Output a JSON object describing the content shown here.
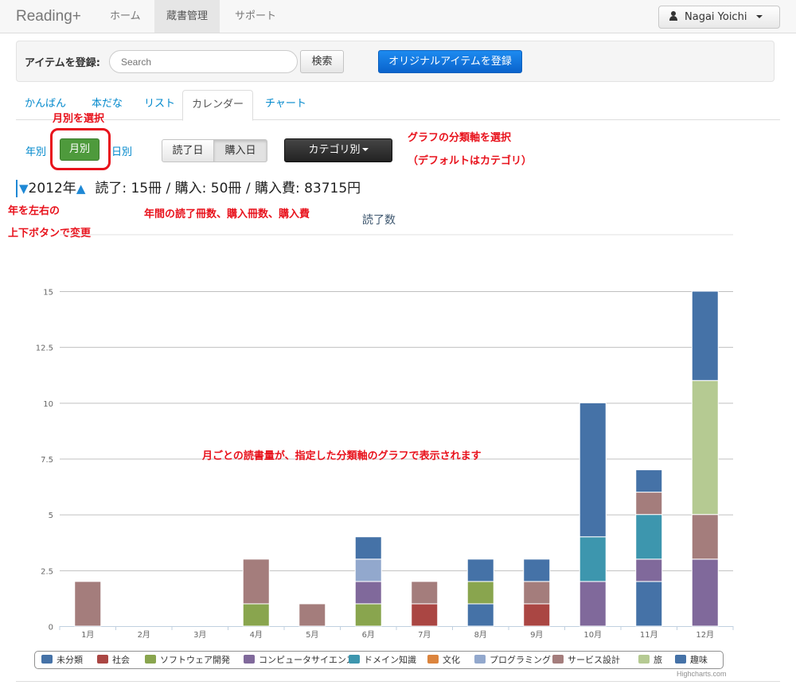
{
  "navbar": {
    "brand": "Reading+",
    "items": [
      {
        "label": "ホーム"
      },
      {
        "label": "蔵書管理"
      },
      {
        "label": "サポート"
      }
    ],
    "user": "Nagai Yoichi"
  },
  "register": {
    "label": "アイテムを登録:",
    "search_placeholder": "Search",
    "search_button": "検索",
    "original_button": "オリジナルアイテムを登録"
  },
  "tabs": [
    {
      "label": "かんばん"
    },
    {
      "label": "本だな"
    },
    {
      "label": "リスト"
    },
    {
      "label": "カレンダー"
    },
    {
      "label": "チャート"
    }
  ],
  "period": {
    "yearly": "年別",
    "monthly": "月別",
    "daily": "日別"
  },
  "date_toggle": {
    "read_date": "読了日",
    "purchase_date": "購入日"
  },
  "category_button": "カテゴリ別",
  "year_line": {
    "down_arrow": "▼",
    "year": "2012年",
    "up_arrow": "▲",
    "stats": "読了: 15冊 / 購入: 50冊 / 購入費: 83715円"
  },
  "annotations": {
    "select_monthly": "月別を選択",
    "select_axis": "グラフの分類軸を選択",
    "default_category": "（デフォルトはカテゴリ）",
    "year_change_1": "年を左右の",
    "year_change_2": "上下ボタンで変更",
    "yearly_counts": "年間の読了冊数、購入冊数、購入費",
    "chart_note": "月ごとの読書量が、指定した分類軸のグラフで表示されます"
  },
  "credits": "Highcharts.com",
  "chart_data": {
    "type": "bar",
    "title": "読了数",
    "stacked": true,
    "categories": [
      "1月",
      "2月",
      "3月",
      "4月",
      "5月",
      "6月",
      "7月",
      "8月",
      "9月",
      "10月",
      "11月",
      "12月"
    ],
    "ylim": [
      0,
      15
    ],
    "yticks": [
      0,
      2.5,
      5,
      7.5,
      10,
      12.5,
      15
    ],
    "ytick_labels": [
      "0",
      "2.5",
      "5",
      "7.5",
      "10",
      "12.5",
      "15"
    ],
    "grid": true,
    "legend_position": "bottom",
    "series": [
      {
        "name": "未分類",
        "color": "#4572a7",
        "values": [
          0,
          0,
          0,
          0,
          0,
          0,
          0,
          1,
          0,
          0,
          2,
          0
        ]
      },
      {
        "name": "社会",
        "color": "#aa4643",
        "values": [
          0,
          0,
          0,
          0,
          0,
          0,
          1,
          0,
          1,
          0,
          0,
          0
        ]
      },
      {
        "name": "ソフトウェア開発",
        "color": "#89a54e",
        "values": [
          0,
          0,
          0,
          1,
          0,
          1,
          0,
          1,
          0,
          0,
          0,
          0
        ]
      },
      {
        "name": "コンピュータサイエンス",
        "color": "#80699b",
        "values": [
          0,
          0,
          0,
          0,
          0,
          1,
          0,
          0,
          0,
          2,
          1,
          3
        ]
      },
      {
        "name": "ドメイン知識",
        "color": "#3d96ae",
        "values": [
          0,
          0,
          0,
          0,
          0,
          0,
          0,
          0,
          0,
          2,
          2,
          0
        ]
      },
      {
        "name": "文化",
        "color": "#db843d",
        "values": [
          0,
          0,
          0,
          0,
          0,
          0,
          0,
          0,
          0,
          0,
          0,
          0
        ]
      },
      {
        "name": "プログラミング",
        "color": "#92a8cd",
        "values": [
          0,
          0,
          0,
          0,
          0,
          1,
          0,
          0,
          0,
          0,
          0,
          0
        ]
      },
      {
        "name": "サービス設計",
        "color": "#a47d7c",
        "values": [
          2,
          0,
          0,
          2,
          1,
          0,
          1,
          0,
          1,
          0,
          1,
          2
        ]
      },
      {
        "name": "旅",
        "color": "#b5ca92",
        "values": [
          0,
          0,
          0,
          0,
          0,
          0,
          0,
          0,
          0,
          0,
          0,
          6
        ]
      },
      {
        "name": "趣味",
        "color": "#4572a7",
        "values": [
          0,
          0,
          0,
          0,
          0,
          1,
          0,
          1,
          1,
          6,
          1,
          4
        ]
      }
    ]
  }
}
